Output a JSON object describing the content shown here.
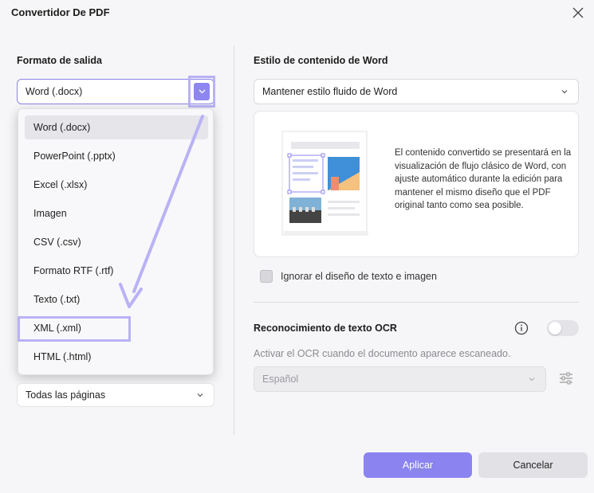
{
  "window": {
    "title": "Convertidor De PDF"
  },
  "output": {
    "label": "Formato de salida",
    "selected": "Word (.docx)",
    "options": [
      "Word (.docx)",
      "PowerPoint (.pptx)",
      "Excel (.xlsx)",
      "Imagen",
      "CSV (.csv)",
      "Formato RTF (.rtf)",
      "Texto (.txt)",
      "XML (.xml)",
      "HTML (.html)"
    ],
    "highlighted_option": "XML (.xml)"
  },
  "pages": {
    "selected": "Todas las páginas"
  },
  "word_style": {
    "label": "Estilo de contenido de Word",
    "selected": "Mantener estilo fluido de Word",
    "description": "El contenido convertido se presentará en la visualización de flujo clásico de Word, con ajuste automático durante la edición para mantener el mismo diseño que el PDF original tanto como sea posible."
  },
  "ignore_layout": {
    "label": "Ignorar el diseño de texto e imagen",
    "checked": false
  },
  "ocr": {
    "label": "Reconocimiento de texto OCR",
    "enabled": false,
    "hint": "Activar el OCR cuando el documento aparece escaneado.",
    "language": "Español"
  },
  "buttons": {
    "apply": "Aplicar",
    "cancel": "Cancelar"
  },
  "colors": {
    "accent": "#8a83f0",
    "highlight": "#b9b2f5"
  }
}
